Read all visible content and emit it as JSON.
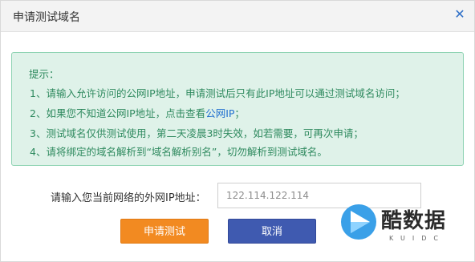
{
  "dialog": {
    "title": "申请测试域名"
  },
  "tips": {
    "title": "提示：",
    "line1": "1、请输入允许访问的公网IP地址，申请测试后只有此IP地址可以通过测试域名访问；",
    "line2_prefix": "2、如果您不知道公网IP地址，点击查看",
    "line2_link": "公网IP",
    "line2_suffix": "；",
    "line3": "3、测试域名仅供测试使用，第二天凌晨3时失效，如若需要，可再次申请；",
    "line4": "4、请将绑定的域名解析到“域名解析别名”，切勿解析到测试域名。"
  },
  "form": {
    "label": "请输入您当前网络的外网IP地址：",
    "ip_value": "122.114.122.114"
  },
  "buttons": {
    "apply": "申请测试",
    "cancel": "取消"
  },
  "watermark": {
    "text": "酷数据",
    "sub": "KUIDC"
  },
  "colors": {
    "tips_bg": "#dff2e9",
    "tips_text": "#2f8a5f",
    "apply_btn": "#f28a21",
    "cancel_btn": "#3f5ab0",
    "close_icon": "#2d6ec7"
  }
}
